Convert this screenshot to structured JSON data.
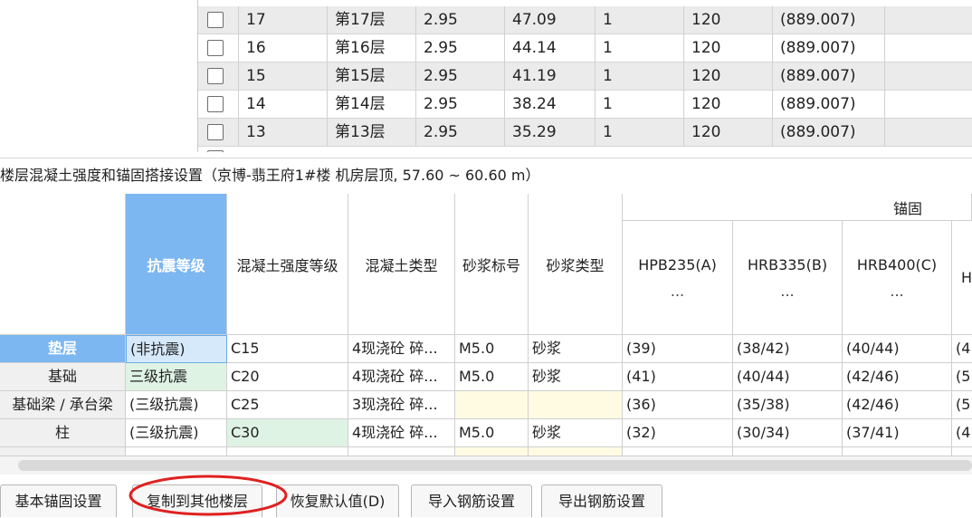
{
  "floor_table": {
    "rows": [
      {
        "num": "17",
        "name": "第17层",
        "height": "2.95",
        "elevation": "47.09",
        "count": "1",
        "thickness": "120",
        "area": "(889.007)"
      },
      {
        "num": "16",
        "name": "第16层",
        "height": "2.95",
        "elevation": "44.14",
        "count": "1",
        "thickness": "120",
        "area": "(889.007)"
      },
      {
        "num": "15",
        "name": "第15层",
        "height": "2.95",
        "elevation": "41.19",
        "count": "1",
        "thickness": "120",
        "area": "(889.007)"
      },
      {
        "num": "14",
        "name": "第14层",
        "height": "2.95",
        "elevation": "38.24",
        "count": "1",
        "thickness": "120",
        "area": "(889.007)"
      },
      {
        "num": "13",
        "name": "第13层",
        "height": "2.95",
        "elevation": "35.29",
        "count": "1",
        "thickness": "120",
        "area": "(889.007)"
      }
    ]
  },
  "section_title": "楼层混凝土强度和锚固搭接设置（京博-翡王府1#楼  机房层顶, 57.60 ~ 60.60 m）",
  "grid": {
    "group_header": "锚固",
    "headers": {
      "seismic": "抗震等级",
      "concrete_grade": "混凝土强度等级",
      "concrete_type": "混凝土类型",
      "mortar_grade": "砂浆标号",
      "mortar_type": "砂浆类型",
      "hpb235": "HPB235(A)",
      "hrb335": "HRB335(B)",
      "hrb400": "HRB400(C)",
      "ellipsis": "...",
      "partial_next": "H"
    },
    "rows": [
      {
        "name": "垫层",
        "seismic": "(非抗震)",
        "grade": "C15",
        "ctype": "4现浇砼 碎...",
        "mortar": "M5.0",
        "mtype": "砂浆",
        "a": "(39)",
        "b": "(38/42)",
        "c": "(40/44)",
        "d": "(4"
      },
      {
        "name": "基础",
        "seismic": "三级抗震",
        "grade": "C20",
        "ctype": "4现浇砼 碎...",
        "mortar": "M5.0",
        "mtype": "砂浆",
        "a": "(41)",
        "b": "(40/44)",
        "c": "(42/46)",
        "d": "(5"
      },
      {
        "name": "基础梁 / 承台梁",
        "seismic": "(三级抗震)",
        "grade": "C25",
        "ctype": "3现浇砼 碎...",
        "mortar": "",
        "mtype": "",
        "a": "(36)",
        "b": "(35/38)",
        "c": "(42/46)",
        "d": "(5"
      },
      {
        "name": "柱",
        "seismic": "(三级抗震)",
        "grade": "C30",
        "ctype": "4现浇砼 碎...",
        "mortar": "M5.0",
        "mtype": "砂浆",
        "a": "(32)",
        "b": "(30/34)",
        "c": "(37/41)",
        "d": "(4"
      }
    ]
  },
  "buttons": {
    "basic_anchor": "基本锚固设置",
    "copy_to_floors": "复制到其他楼层",
    "restore_default": "恢复默认值(D)",
    "import_rebar": "导入钢筋设置",
    "export_rebar": "导出钢筋设置"
  },
  "colors": {
    "selected_header": "#7cb7f1",
    "annotation": "#e02020"
  }
}
